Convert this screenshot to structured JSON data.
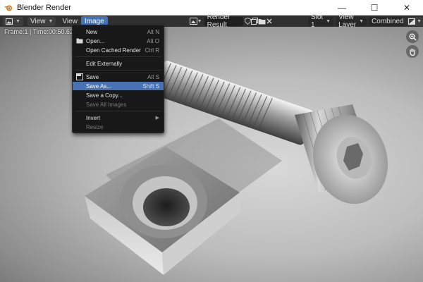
{
  "window": {
    "title": "Blender Render",
    "controls": {
      "minimize": "—",
      "maximize": "☐",
      "close": "✕"
    }
  },
  "header": {
    "view_menu_label": "View",
    "view_label": "View",
    "image_label": "Image",
    "image_name": "Render Result",
    "slot": "Slot 1",
    "view_layer": "View Layer",
    "pass": "Combined"
  },
  "viewport": {
    "frame_info": "Frame:1 | Time:00:50.62 | M"
  },
  "image_menu": {
    "items": [
      {
        "label": "New",
        "shortcut": "Alt N",
        "icon": ""
      },
      {
        "label": "Open...",
        "shortcut": "Alt O",
        "icon": "folder-icon"
      },
      {
        "label": "Open Cached Render",
        "shortcut": "Ctrl R",
        "icon": ""
      },
      {
        "label": "Edit Externally",
        "shortcut": "",
        "icon": ""
      },
      {
        "label": "Save",
        "shortcut": "Alt S",
        "icon": "save-icon"
      },
      {
        "label": "Save As...",
        "shortcut": "Shift S",
        "icon": ""
      },
      {
        "label": "Save a Copy...",
        "shortcut": "",
        "icon": ""
      },
      {
        "label": "Save All Images",
        "shortcut": "",
        "icon": ""
      },
      {
        "label": "Invert",
        "shortcut": "",
        "icon": ""
      },
      {
        "label": "Resize",
        "shortcut": "",
        "icon": ""
      }
    ],
    "highlighted": "Save As...",
    "disabled": [
      "Save All Images",
      "Resize"
    ]
  },
  "colors": {
    "accent": "#4772b3",
    "header_bg": "#303030",
    "menu_bg": "#181818"
  }
}
